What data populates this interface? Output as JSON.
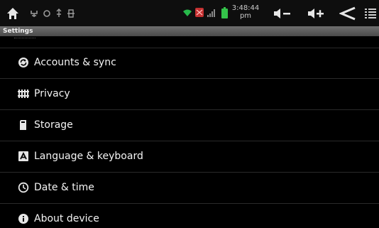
{
  "status_bar": {
    "time_line1": "3:48:44",
    "time_line2": "pm",
    "icons": [
      "home-icon",
      "usb-icon",
      "sync-icon",
      "usb-debug-icon",
      "sd-icon",
      "wifi-icon",
      "no-signal-icon",
      "signal-icon",
      "battery-icon",
      "volume-down-icon",
      "volume-up-icon",
      "back-icon",
      "menu-icon"
    ]
  },
  "title_bar": {
    "title": "Settings"
  },
  "settings": {
    "items": [
      {
        "label": "Accounts & sync",
        "icon": "accounts-sync-icon"
      },
      {
        "label": "Privacy",
        "icon": "privacy-icon"
      },
      {
        "label": "Storage",
        "icon": "storage-icon"
      },
      {
        "label": "Language & keyboard",
        "icon": "language-keyboard-icon"
      },
      {
        "label": "Date & time",
        "icon": "clock-icon"
      },
      {
        "label": "About device",
        "icon": "info-icon"
      }
    ]
  }
}
